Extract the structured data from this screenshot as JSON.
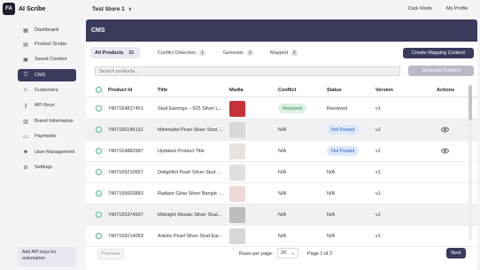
{
  "app": {
    "logo_text": "FA",
    "name": "AI Scribe"
  },
  "topbar": {
    "store": "Test Store 1",
    "dark_mode": "Dark Mode",
    "my_profile": "My Profile"
  },
  "sidebar": {
    "items": [
      {
        "label": "Dashboard",
        "icon": "grid-icon",
        "active": false
      },
      {
        "label": "Product Scribe",
        "icon": "document-icon",
        "active": false
      },
      {
        "label": "Saved Content",
        "icon": "save-icon",
        "active": false
      },
      {
        "label": "CMS",
        "icon": "filter-icon",
        "active": true
      },
      {
        "label": "Customers",
        "icon": "users-icon",
        "active": false
      },
      {
        "label": "API Keys",
        "icon": "key-icon",
        "active": false
      },
      {
        "label": "Brand Information",
        "icon": "building-icon",
        "active": false
      },
      {
        "label": "Payments",
        "icon": "card-icon",
        "active": false
      },
      {
        "label": "User Management",
        "icon": "user-icon",
        "active": false
      },
      {
        "label": "Settings",
        "icon": "gear-icon",
        "active": false
      }
    ],
    "api_card": "Add API keys for automation"
  },
  "main": {
    "title": "CMS",
    "tabs": [
      {
        "label": "All Products",
        "count": "33",
        "active": true
      },
      {
        "label": "Conflict Detection",
        "count": "1",
        "active": false
      },
      {
        "label": "Generate",
        "count": "2",
        "active": false
      },
      {
        "label": "Mapped",
        "count": "2",
        "active": false
      }
    ],
    "create_button": "Create Mapping Content",
    "search_placeholder": "Search products...",
    "generate_button": "Generate Content"
  },
  "table": {
    "columns": [
      "Product Id",
      "Title",
      "Media",
      "Conflict",
      "Status",
      "Version",
      "Actions"
    ],
    "rows": [
      {
        "id": "7407164817451",
        "title": "Stud Earrings – 925 Silver L...",
        "thumb": "#c8303a",
        "conflict": "Resolved",
        "conflict_badge": true,
        "status": "Resolved",
        "status_badge": false,
        "version": "v1",
        "action": false
      },
      {
        "id": "7407165145131",
        "title": "Minimalist Pearl Silver Stud ...",
        "thumb": "#d6d8dc",
        "conflict": "N/A",
        "conflict_badge": false,
        "status": "Not Posted",
        "status_badge": true,
        "version": "v1",
        "action": true
      },
      {
        "id": "7407164882987",
        "title": "Updated Product Title",
        "thumb": "#e6e2de",
        "conflict": "N/A",
        "conflict_badge": false,
        "status": "Not Posted",
        "status_badge": true,
        "version": "v1",
        "action": true
      },
      {
        "id": "7407165210667",
        "title": "Delightful Pearl Silver Stud ...",
        "thumb": "#dfe0e2",
        "conflict": "N/A",
        "conflict_badge": false,
        "status": "N/A",
        "status_badge": false,
        "version": "v1",
        "action": false
      },
      {
        "id": "7407165603883",
        "title": "Radiant Glow Silver Bangle -...",
        "thumb": "#eed9d6",
        "conflict": "N/A",
        "conflict_badge": false,
        "status": "N/A",
        "status_badge": false,
        "version": "v1",
        "action": false
      },
      {
        "id": "7407165374507",
        "title": "Midnight Mosaic Silver Stud...",
        "thumb": "#bcbcc0",
        "conflict": "N/A",
        "conflict_badge": false,
        "status": "N/A",
        "status_badge": false,
        "version": "v1",
        "action": false
      },
      {
        "id": "7407165014059",
        "title": "Artistic Pearl Silver Stud Ear...",
        "thumb": "#d8d8da",
        "conflict": "N/A",
        "conflict_badge": false,
        "status": "N/A",
        "status_badge": false,
        "version": "v1",
        "action": false
      }
    ]
  },
  "footer": {
    "previous": "Previous",
    "rows_label": "Rows per page:",
    "rows_value": "20",
    "page_info": "Page 1 of 2",
    "next": "Next"
  },
  "colors": {
    "accent": "#3a3a5c",
    "resolved_bg": "#dcf2e4",
    "not_posted_bg": "#dde8fb"
  }
}
